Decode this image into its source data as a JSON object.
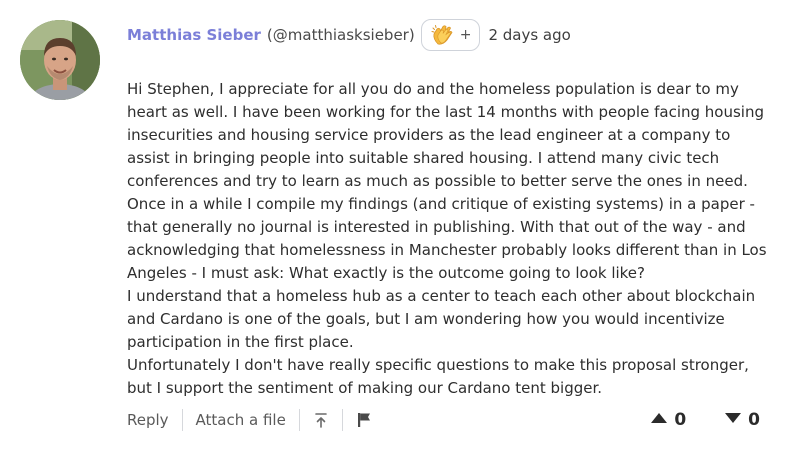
{
  "comment": {
    "author_name": "Matthias Sieber",
    "author_handle": "(@matthiasksieber)",
    "reaction": {
      "icon": "clap-emoji-icon",
      "add_label": "+"
    },
    "timestamp": "2 days ago",
    "body_paragraphs": [
      "Hi Stephen, I appreciate for all you do and the homeless population is dear to my heart as well. I have been working for the last 14 months with people facing housing insecurities and housing service providers as the lead engineer at a company to assist in bringing people into suitable shared housing. I attend many civic tech conferences and try to learn as much as possible to better serve the ones in need. Once in a while I compile my findings (and critique of existing systems) in a paper - that generally no journal is interested in publishing. With that out of the way - and acknowledging that homelessness in Manchester probably looks different than in Los Angeles - I must ask: What exactly is the outcome going to look like?",
      "I understand that a homeless hub as a center to teach each other about blockchain and Cardano is one of the goals, but I am wondering how you would incentivize participation in the first place.",
      "Unfortunately I don't have really specific questions to make this proposal stronger, but I support the sentiment of making our Cardano tent bigger."
    ]
  },
  "actions": {
    "reply_label": "Reply",
    "attach_label": "Attach a file",
    "upload_icon": "upload-icon",
    "flag_icon": "flag-icon"
  },
  "votes": {
    "up_count": "0",
    "down_count": "0",
    "up_icon": "arrow-up-icon",
    "down_icon": "arrow-down-icon"
  },
  "colors": {
    "author_name": "#7b7fd8",
    "text": "#2e2e2e",
    "muted": "#5a5a5a",
    "border": "#cfd3da"
  }
}
